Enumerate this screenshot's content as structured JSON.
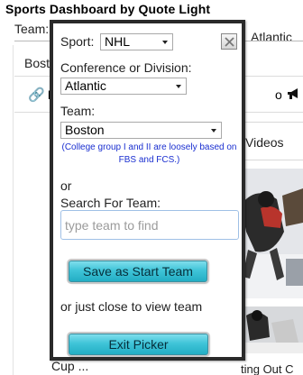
{
  "app": {
    "title": "Sports Dashboard by Quote Light"
  },
  "background": {
    "team_label": "Team:",
    "team_value": "Atlantic",
    "city": "Bosto",
    "tab_links_label": "L",
    "tab_partial_label": "o",
    "videos_tab_label": "Videos",
    "caption_partial": "ting Out C",
    "cup_text": "Cup ..."
  },
  "picker": {
    "sport_label": "Sport:",
    "sport_value": "NHL",
    "conference_label": "Conference or Division:",
    "conference_value": "Atlantic",
    "team_label": "Team:",
    "team_value": "Boston",
    "note": "(College group I and II are loosely based on FBS and FCS.)",
    "or_text": "or",
    "search_label": "Search For Team:",
    "search_placeholder": "type team to find",
    "search_value": "",
    "save_button": "Save as Start Team",
    "close_hint": "or just close to view team",
    "exit_button": "Exit Picker"
  },
  "colors": {
    "note_text": "#1a2fd0",
    "button_fill": "#3fc4d8",
    "modal_border": "#2a2a2a"
  },
  "icons": {
    "close": "close-icon",
    "dropdown": "chevron-down-icon",
    "tab_links": "link-icon",
    "tab_news": "megaphone-icon"
  }
}
